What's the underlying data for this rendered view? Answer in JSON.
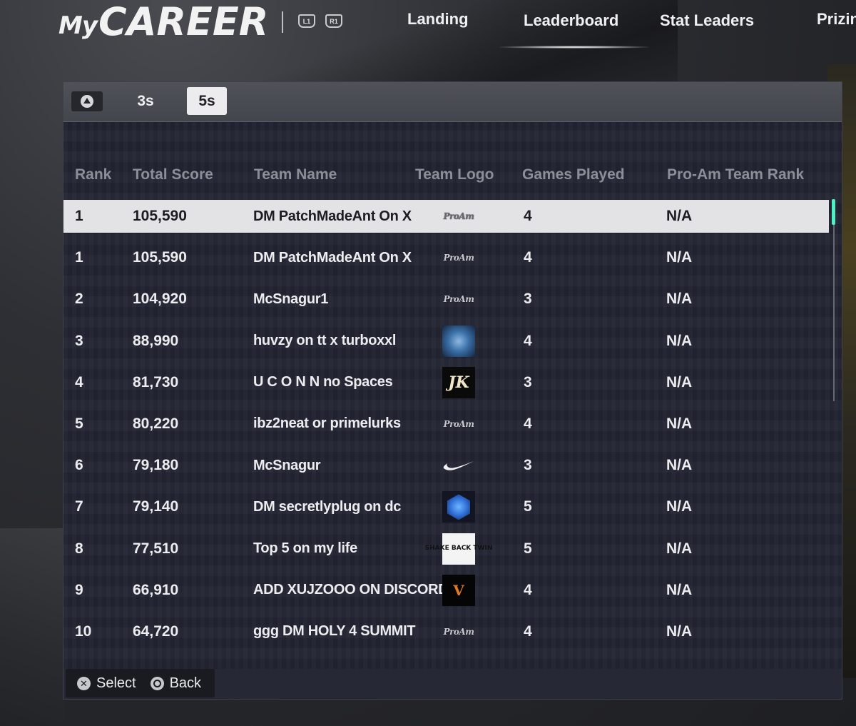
{
  "header": {
    "logo_my": "My",
    "logo_career": "CAREER",
    "bumper_left": "L1",
    "bumper_right": "R1",
    "nav": [
      "Landing",
      "Leaderboard",
      "Stat Leaders",
      "Prizin"
    ],
    "active_nav": "Leaderboard"
  },
  "tabs": {
    "items": [
      "3s",
      "5s"
    ],
    "selected": "5s",
    "toggle_icon": "triangle-icon"
  },
  "table": {
    "columns": [
      "Rank",
      "Total Score",
      "Team Name",
      "Team Logo",
      "Games Played",
      "Pro-Am Team Rank"
    ],
    "rows": [
      {
        "rank": "1",
        "score": "105,590",
        "name": "DM PatchMadeAnt On X",
        "logo": "proam-logo",
        "logo_text": "ProAm",
        "games": "4",
        "proam_rank": "N/A",
        "selected": true
      },
      {
        "rank": "1",
        "score": "105,590",
        "name": "DM PatchMadeAnt On X",
        "logo": "proam-logo",
        "logo_text": "ProAm",
        "games": "4",
        "proam_rank": "N/A"
      },
      {
        "rank": "2",
        "score": "104,920",
        "name": "McSnagur1",
        "logo": "proam-logo",
        "logo_text": "ProAm",
        "games": "3",
        "proam_rank": "N/A"
      },
      {
        "rank": "3",
        "score": "88,990",
        "name": "huvzy on tt  x turboxxl",
        "logo": "wolf-logo",
        "logo_text": "",
        "games": "4",
        "proam_rank": "N/A"
      },
      {
        "rank": "4",
        "score": "81,730",
        "name": "U C O N N no Spaces",
        "logo": "jk-logo",
        "logo_text": "JK",
        "games": "3",
        "proam_rank": "N/A"
      },
      {
        "rank": "5",
        "score": "80,220",
        "name": "ibz2neat or primelurks",
        "logo": "proam-logo",
        "logo_text": "ProAm",
        "games": "4",
        "proam_rank": "N/A"
      },
      {
        "rank": "6",
        "score": "79,180",
        "name": "McSnagur",
        "logo": "swoosh-logo",
        "logo_text": "",
        "games": "3",
        "proam_rank": "N/A"
      },
      {
        "rank": "7",
        "score": "79,140",
        "name": "DM secretlyplug on dc",
        "logo": "tme-logo",
        "logo_text": "",
        "games": "5",
        "proam_rank": "N/A"
      },
      {
        "rank": "8",
        "score": "77,510",
        "name": "Top 5 on my life",
        "logo": "shake-logo",
        "logo_text": "SHAKE BACK TWIN",
        "games": "5",
        "proam_rank": "N/A"
      },
      {
        "rank": "9",
        "score": "66,910",
        "name": "ADD XUJZOOO ON DISCORD",
        "logo": "v-logo",
        "logo_text": "V",
        "games": "4",
        "proam_rank": "N/A"
      },
      {
        "rank": "10",
        "score": "64,720",
        "name": "ggg DM HOLY 4 SUMMIT",
        "logo": "proam-logo",
        "logo_text": "ProAm",
        "games": "4",
        "proam_rank": "N/A"
      }
    ]
  },
  "footer": {
    "select_label": "Select",
    "back_label": "Back",
    "select_icon": "cross-button-icon",
    "back_icon": "circle-button-icon"
  },
  "colors": {
    "panel_bg": "#262835",
    "selected_row_bg": "#e3e3e6",
    "header_text": "#8d8f98",
    "scroll_accent": "#4ff0c8",
    "active_tab_bg": "#ececee"
  }
}
